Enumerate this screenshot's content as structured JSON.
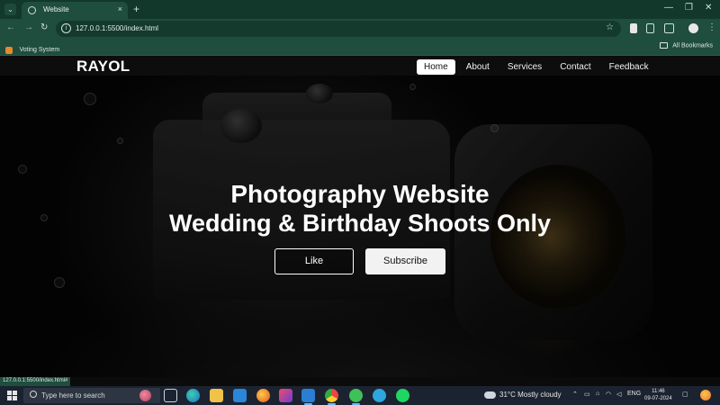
{
  "browser": {
    "tab_title": "Website",
    "tab_close": "×",
    "new_tab": "+",
    "url": "127.0.0.1:5500/index.html",
    "bookmark": "Voting System",
    "all_bookmarks": "All Bookmarks",
    "status_url": "127.0.0.1:5500/index.html#"
  },
  "site": {
    "brand": "RAYOL",
    "nav": [
      {
        "label": "Home",
        "active": true
      },
      {
        "label": "About",
        "active": false
      },
      {
        "label": "Services",
        "active": false
      },
      {
        "label": "Contact",
        "active": false
      },
      {
        "label": "Feedback",
        "active": false
      }
    ],
    "hero": {
      "title_line1": "Photography Website",
      "title_line2": "Wedding & Birthday Shoots Only",
      "like_button": "Like",
      "subscribe_button": "Subscribe"
    }
  },
  "taskbar": {
    "search_placeholder": "Type here to search",
    "weather": "31°C  Mostly cloudy",
    "language": "ENG",
    "time": "11:46",
    "date": "09-07-2024"
  },
  "colors": {
    "browser_frame": "#1f4d3e",
    "tab_strip": "#12382b",
    "taskbar": "#1c2330",
    "active_nav_bg": "#ffffff"
  }
}
